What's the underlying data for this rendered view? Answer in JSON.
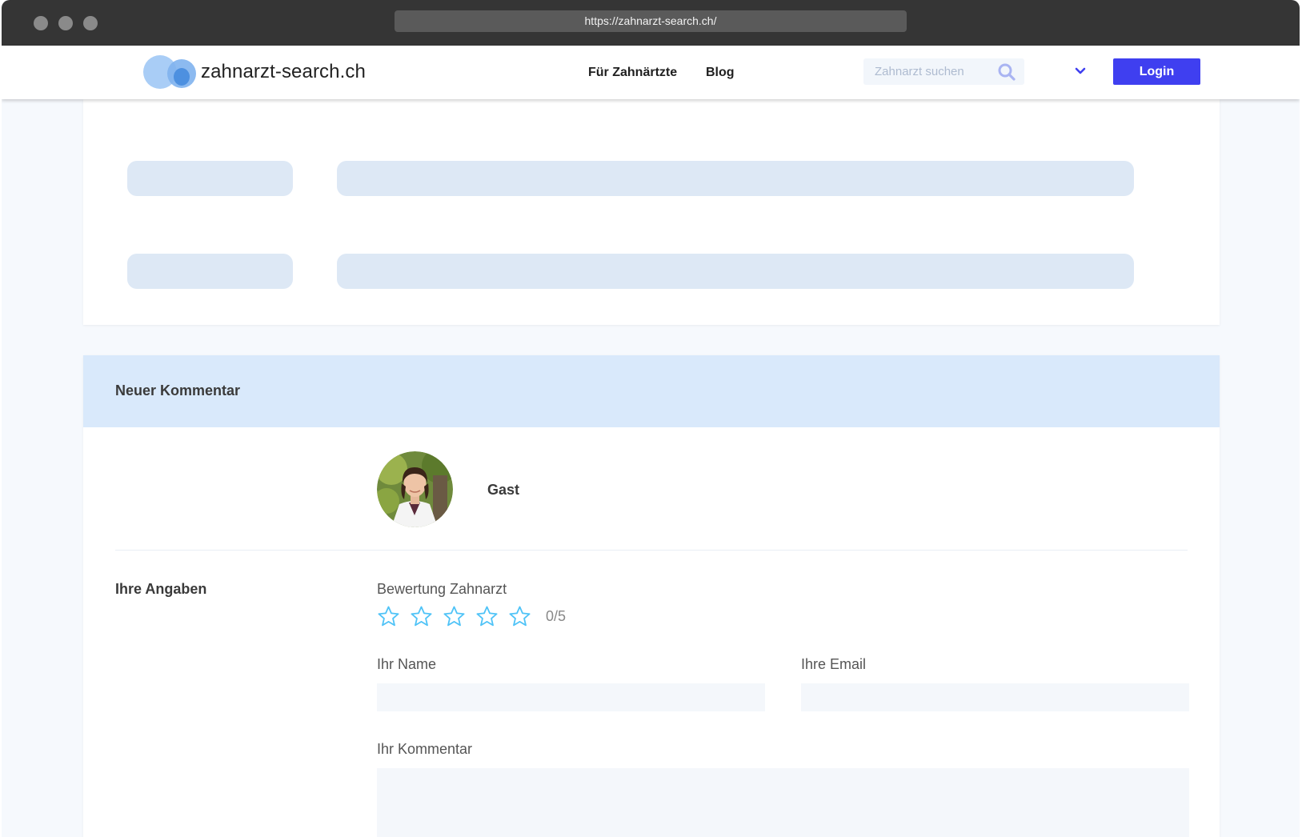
{
  "browser": {
    "url": "https://zahnarzt-search.ch/"
  },
  "header": {
    "logo_text": "zahnarzt-search.ch",
    "nav": [
      {
        "label": "Für Zahnärtzte"
      },
      {
        "label": "Blog"
      }
    ],
    "search": {
      "placeholder": "Zahnarzt suchen",
      "value": ""
    },
    "login_label": "Login"
  },
  "comment_form": {
    "title": "Neuer Kommentar",
    "user_name": "Gast",
    "section_label": "Ihre Angaben",
    "rating": {
      "label": "Bewertung Zahnarzt",
      "value": 0,
      "max": 5,
      "text": "0/5"
    },
    "name_label": "Ihr Name",
    "email_label": "Ihre Email",
    "comment_label": "Ihr Kommentar",
    "name_value": "",
    "email_value": "",
    "comment_value": ""
  },
  "colors": {
    "accent": "#3f3ff0",
    "star_outline": "#4fc3f7",
    "panel_header": "#d9e9fb",
    "skeleton": "#dde8f5"
  }
}
